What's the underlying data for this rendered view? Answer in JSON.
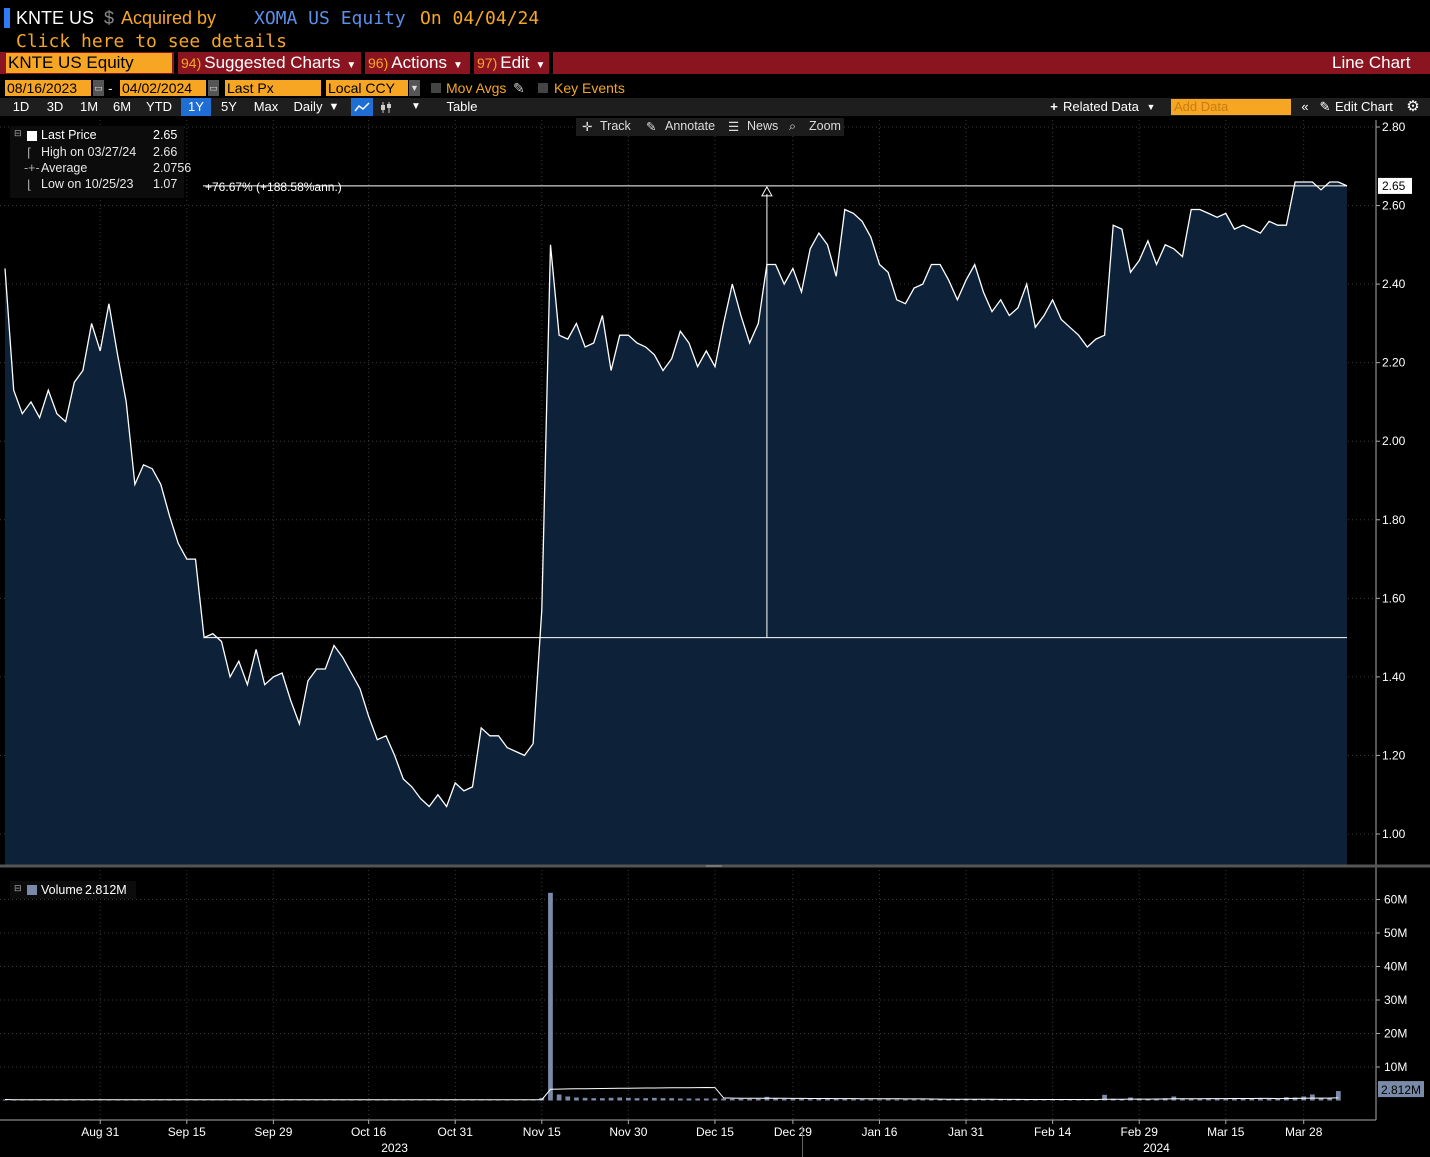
{
  "header": {
    "ticker": "KNTE US",
    "currency_symbol": "$",
    "acquired_by_label": "Acquired by",
    "acquirer": "XOMA US Equity",
    "on_label": "On 04/04/24",
    "details_link": "Click here to see details"
  },
  "menubar": {
    "security": "KNTE US Equity",
    "items": [
      {
        "num": "94)",
        "label": "Suggested Charts"
      },
      {
        "num": "96)",
        "label": "Actions"
      },
      {
        "num": "97)",
        "label": "Edit"
      }
    ],
    "view_title": "Line Chart"
  },
  "controls": {
    "start_date": "08/16/2023",
    "dash": "-",
    "end_date": "04/02/2024",
    "price_field": "Last Px",
    "currency": "Local CCY",
    "mov_avgs": "Mov Avgs",
    "key_events": "Key Events"
  },
  "toolbar": {
    "ranges": [
      "1D",
      "3D",
      "1M",
      "6M",
      "YTD",
      "1Y",
      "5Y",
      "Max"
    ],
    "active_range": "1Y",
    "frequency": "Daily",
    "table": "Table",
    "related_data": "Related Data",
    "add_data_placeholder": "Add Data",
    "edit_chart": "Edit Chart"
  },
  "chart_tools": {
    "track": "Track",
    "annotate": "Annotate",
    "news": "News",
    "zoom": "Zoom"
  },
  "legend": {
    "last_price_label": "Last Price",
    "last_price": "2.65",
    "high_label": "High on 03/27/24",
    "high": "2.66",
    "average_label": "Average",
    "average": "2.0756",
    "low_label": "Low on 10/25/23",
    "low": "1.07"
  },
  "volume_legend": {
    "label": "Volume",
    "value": "2.812M"
  },
  "annotation": {
    "change_text": "+76.67% (+188.58%ann.)"
  },
  "colors": {
    "background": "#000000",
    "area_fill": "#0d2239",
    "line": "#ffffff",
    "accent_orange": "#f6a623",
    "menubar_red": "#8a1521",
    "blue_link": "#5b8fe8",
    "volume_bar": "#7b8aa8"
  },
  "chart_data": {
    "type": "area",
    "price_axis": {
      "min": 0.92,
      "max": 2.82,
      "ticks": [
        1.0,
        1.2,
        1.4,
        1.6,
        1.8,
        2.0,
        2.2,
        2.4,
        2.6,
        2.8
      ],
      "labels": [
        "1.00",
        "1.20",
        "1.40",
        "1.60",
        "1.80",
        "2.00",
        "2.20",
        "2.40",
        "2.60",
        "2.80"
      ],
      "last_label": "2.65"
    },
    "x_axis": {
      "labels": [
        "Aug 31",
        "Sep 15",
        "Sep 29",
        "Oct 16",
        "Oct 31",
        "Nov 15",
        "Nov 30",
        "Dec 15",
        "Dec 29",
        "Jan 16",
        "Jan 31",
        "Feb 14",
        "Feb 29",
        "Mar 15",
        "Mar 28"
      ],
      "label_index": [
        11,
        21,
        31,
        42,
        52,
        62,
        72,
        82,
        91,
        101,
        111,
        121,
        131,
        141,
        150
      ],
      "year_labels": [
        "2023",
        "2024"
      ],
      "year_index": [
        45,
        133
      ]
    },
    "price": [
      2.44,
      2.13,
      2.07,
      2.1,
      2.06,
      2.13,
      2.07,
      2.05,
      2.15,
      2.18,
      2.3,
      2.23,
      2.35,
      2.22,
      2.1,
      1.89,
      1.94,
      1.93,
      1.89,
      1.81,
      1.74,
      1.7,
      1.7,
      1.5,
      1.51,
      1.49,
      1.4,
      1.44,
      1.38,
      1.47,
      1.38,
      1.4,
      1.41,
      1.34,
      1.28,
      1.39,
      1.42,
      1.42,
      1.48,
      1.45,
      1.41,
      1.37,
      1.3,
      1.24,
      1.25,
      1.2,
      1.14,
      1.12,
      1.09,
      1.07,
      1.1,
      1.07,
      1.13,
      1.11,
      1.12,
      1.27,
      1.25,
      1.25,
      1.22,
      1.21,
      1.2,
      1.23,
      1.57,
      2.5,
      2.27,
      2.26,
      2.3,
      2.24,
      2.25,
      2.32,
      2.18,
      2.27,
      2.27,
      2.25,
      2.24,
      2.22,
      2.18,
      2.21,
      2.28,
      2.25,
      2.19,
      2.23,
      2.19,
      2.3,
      2.4,
      2.32,
      2.25,
      2.3,
      2.45,
      2.45,
      2.4,
      2.44,
      2.38,
      2.49,
      2.53,
      2.5,
      2.42,
      2.59,
      2.58,
      2.56,
      2.52,
      2.45,
      2.43,
      2.36,
      2.35,
      2.39,
      2.4,
      2.45,
      2.45,
      2.41,
      2.36,
      2.41,
      2.45,
      2.38,
      2.33,
      2.36,
      2.32,
      2.34,
      2.4,
      2.29,
      2.32,
      2.36,
      2.31,
      2.29,
      2.27,
      2.24,
      2.26,
      2.27,
      2.55,
      2.54,
      2.43,
      2.46,
      2.51,
      2.45,
      2.5,
      2.49,
      2.47,
      2.59,
      2.59,
      2.58,
      2.57,
      2.58,
      2.54,
      2.55,
      2.54,
      2.53,
      2.56,
      2.55,
      2.55,
      2.66,
      2.66,
      2.66,
      2.64,
      2.66,
      2.66,
      2.65
    ],
    "volume_axis": {
      "min": 0,
      "max": 64,
      "unit": "M",
      "ticks": [
        10,
        20,
        30,
        40,
        50,
        60
      ],
      "labels": [
        "10M",
        "20M",
        "30M",
        "40M",
        "50M",
        "60M"
      ],
      "last_label": "2.812M"
    },
    "volume": [
      0.3,
      0.2,
      0.2,
      0.3,
      0.2,
      0.2,
      0.2,
      0.2,
      0.3,
      0.2,
      0.3,
      0.2,
      0.3,
      0.3,
      0.2,
      0.3,
      0.2,
      0.2,
      0.2,
      0.2,
      0.2,
      0.3,
      0.2,
      0.3,
      0.2,
      0.2,
      0.2,
      0.2,
      0.2,
      0.2,
      0.2,
      0.2,
      0.2,
      0.2,
      0.2,
      0.2,
      0.2,
      0.2,
      0.2,
      0.2,
      0.2,
      0.2,
      0.2,
      0.2,
      0.2,
      0.2,
      0.2,
      0.2,
      0.2,
      0.2,
      0.2,
      0.2,
      0.2,
      0.3,
      0.2,
      0.3,
      0.2,
      0.2,
      0.2,
      0.2,
      0.2,
      0.3,
      0.8,
      62,
      1.8,
      1.2,
      0.9,
      0.8,
      0.7,
      0.7,
      0.8,
      0.9,
      0.8,
      0.7,
      0.7,
      0.8,
      0.7,
      0.7,
      0.6,
      0.6,
      0.6,
      0.6,
      0.6,
      0.6,
      0.5,
      0.5,
      0.5,
      0.5,
      1.1,
      0.6,
      0.5,
      0.5,
      0.5,
      0.4,
      0.6,
      0.5,
      0.6,
      0.5,
      0.4,
      0.4,
      0.3,
      0.3,
      0.4,
      0.3,
      0.3,
      0.3,
      0.3,
      0.3,
      0.3,
      0.3,
      0.3,
      0.3,
      0.3,
      0.3,
      0.3,
      0.3,
      0.3,
      0.3,
      0.3,
      0.3,
      0.3,
      0.3,
      0.2,
      0.3,
      0.3,
      0.2,
      0.3,
      1.7,
      0.5,
      0.4,
      0.9,
      0.6,
      0.5,
      0.5,
      0.7,
      1.2,
      0.5,
      0.6,
      0.6,
      0.5,
      0.5,
      0.5,
      0.5,
      0.5,
      0.5,
      0.6,
      0.5,
      0.5,
      1.0,
      0.9,
      1.2,
      1.8,
      0.7,
      0.8,
      2.812
    ]
  }
}
